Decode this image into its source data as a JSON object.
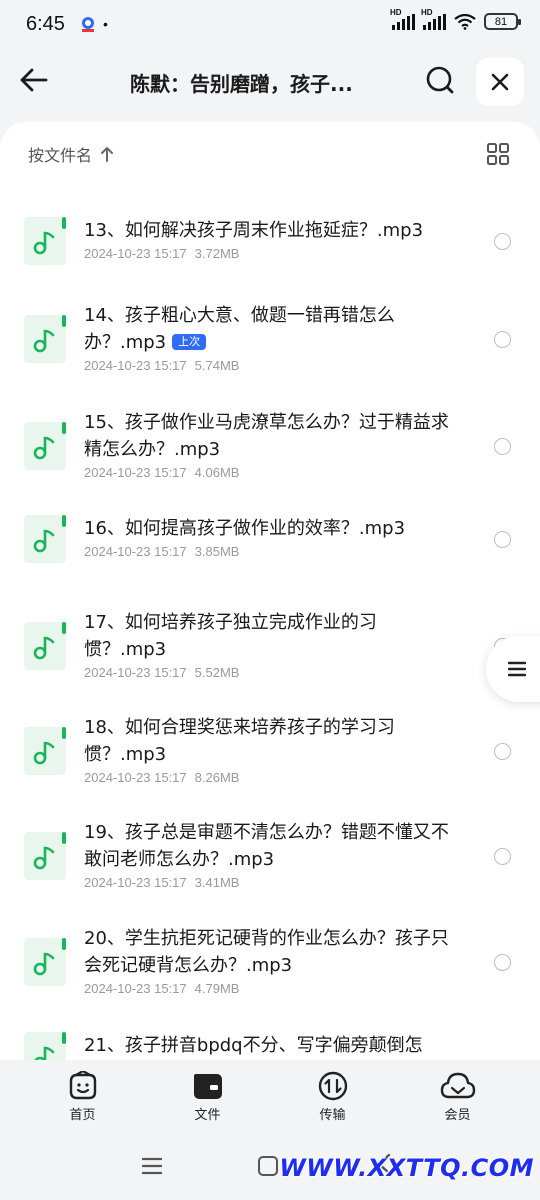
{
  "status_bar": {
    "time": "6:45",
    "dot": "•",
    "sim1": "HD",
    "sim2": "HD",
    "battery": "81"
  },
  "header": {
    "title": "陈默：告别磨蹭，孩子..."
  },
  "sort": {
    "label": "按文件名"
  },
  "files": [
    {
      "name": "13、如何解决孩子周末作业拖延症？.mp3",
      "date": "2024-10-23 15:17",
      "size": "3.72MB",
      "badge": ""
    },
    {
      "name": "14、孩子粗心大意、做题一错再错怎么办？.mp3",
      "date": "2024-10-23 15:17",
      "size": "5.74MB",
      "badge": "上次"
    },
    {
      "name": "15、孩子做作业马虎潦草怎么办？过于精益求精怎么办？.mp3",
      "date": "2024-10-23 15:17",
      "size": "4.06MB",
      "badge": ""
    },
    {
      "name": "16、如何提高孩子做作业的效率？.mp3",
      "date": "2024-10-23 15:17",
      "size": "3.85MB",
      "badge": ""
    },
    {
      "name": "17、如何培养孩子独立完成作业的习惯？.mp3",
      "date": "2024-10-23 15:17",
      "size": "5.52MB",
      "badge": ""
    },
    {
      "name": "18、如何合理奖惩来培养孩子的学习习惯？.mp3",
      "date": "2024-10-23 15:17",
      "size": "8.26MB",
      "badge": ""
    },
    {
      "name": "19、孩子总是审题不清怎么办？错题不懂又不敢问老师怎么办？.mp3",
      "date": "2024-10-23 15:17",
      "size": "3.41MB",
      "badge": ""
    },
    {
      "name": "20、学生抗拒死记硬背的作业怎么办？孩子只会死记硬背怎么办？.mp3",
      "date": "2024-10-23 15:17",
      "size": "4.79MB",
      "badge": ""
    },
    {
      "name": "21、孩子拼音bpdq不分、写字偏旁颠倒怎",
      "date": "",
      "size": "",
      "badge": ""
    }
  ],
  "bottom_nav": {
    "home": "首页",
    "files": "文件",
    "transfer": "传输",
    "member": "会员"
  },
  "watermark": "WWW.XXTTQ.COM",
  "colors": {
    "accent_green": "#19b55a",
    "badge_blue": "#2f6bf5",
    "watermark_blue": "#1d2ef0"
  }
}
